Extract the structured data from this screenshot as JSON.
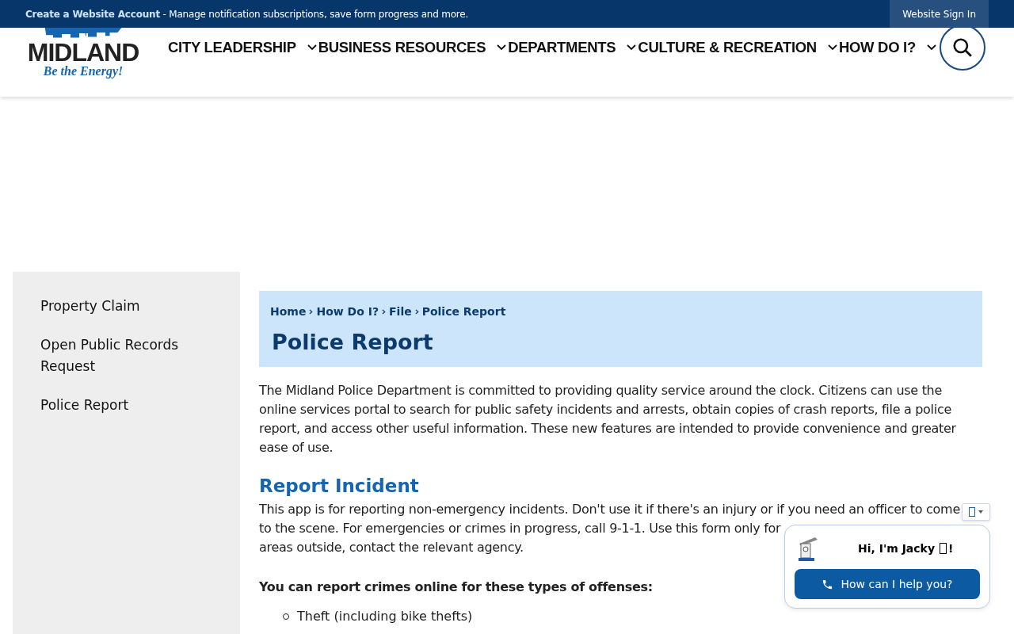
{
  "top_bar": {
    "account_link": "Create a Website Account",
    "account_note": " - Manage notification subscriptions, save form progress and more.",
    "sign_in": "Website Sign In"
  },
  "logo": {
    "name": "MIDLAND",
    "tagline": "Be the Energy!"
  },
  "nav": [
    {
      "label": "CITY LEADERSHIP"
    },
    {
      "label": "BUSINESS RESOURCES"
    },
    {
      "label": "DEPARTMENTS"
    },
    {
      "label": "CULTURE & RECREATION"
    },
    {
      "label": "HOW DO I?"
    }
  ],
  "sidebar": {
    "items": [
      {
        "label": "Property Claim"
      },
      {
        "label": "Open Public Records Request"
      },
      {
        "label": "Police Report"
      }
    ]
  },
  "breadcrumb": [
    "Home",
    "How Do I?",
    "File",
    "Police Report"
  ],
  "page_title": "Police Report",
  "intro": "The Midland Police Department is committed to providing quality service around the clock. Citizens can use the online services portal to search for public safety incidents and arrests, obtain copies of crash reports, file a police report, and access other useful information. These new features are intended to provide convenience and greater ease of use.",
  "section_title": "Report Incident",
  "section_lines": [
    "This app is for reporting non-emergency incidents. Don't use it if there's an injury or if you need an officer to come",
    "to the scene. For emergencies or crimes in progress, call 9-1-1. Use this form only for",
    "areas outside, contact the relevant agency."
  ],
  "offenses_heading": "You can report crimes online for these types of offenses:",
  "offenses": [
    "Theft (including bike thefts)"
  ],
  "chat": {
    "greeting": "Hi, I'm Jacky",
    "greeting_end": "!",
    "button": "How can I help you?"
  }
}
